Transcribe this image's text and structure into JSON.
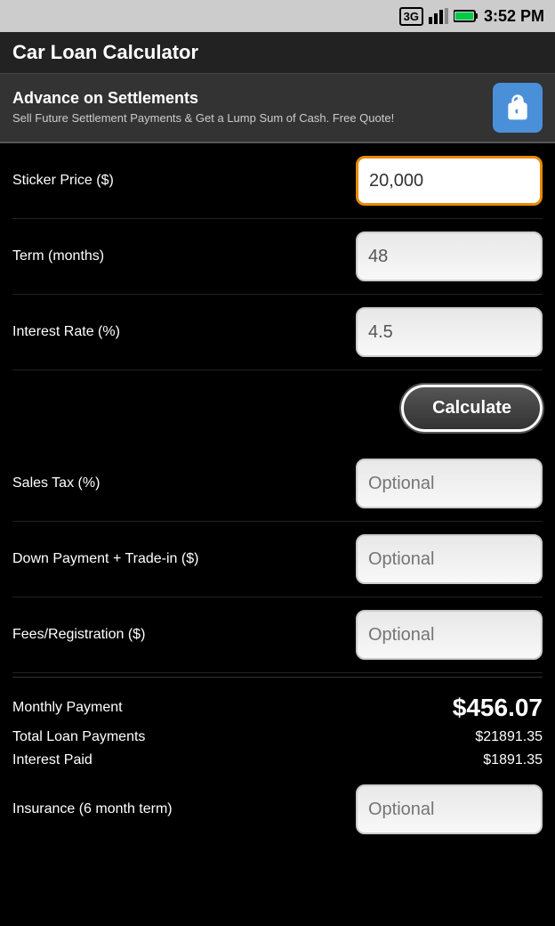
{
  "statusBar": {
    "time": "3:52 PM"
  },
  "titleBar": {
    "title": "Car Loan Calculator"
  },
  "adBanner": {
    "title": "Advance on Settlements",
    "subtitle": "Sell Future Settlement Payments & Get a Lump Sum of Cash. Free Quote!",
    "buttonIcon": "share"
  },
  "form": {
    "fields": [
      {
        "id": "sticker-price",
        "label": "Sticker Price ($)",
        "value": "20,000",
        "placeholder": "",
        "optional": false,
        "active": true
      },
      {
        "id": "term",
        "label": "Term (months)",
        "value": "48",
        "placeholder": "",
        "optional": false,
        "active": false
      },
      {
        "id": "interest-rate",
        "label": "Interest Rate (%)",
        "value": "4.5",
        "placeholder": "",
        "optional": false,
        "active": false
      }
    ],
    "optionalFields": [
      {
        "id": "sales-tax",
        "label": "Sales Tax (%)",
        "placeholder": "Optional"
      },
      {
        "id": "down-payment",
        "label": "Down Payment + Trade-in ($)",
        "placeholder": "Optional"
      },
      {
        "id": "fees-registration",
        "label": "Fees/Registration ($)",
        "placeholder": "Optional"
      }
    ],
    "calculateLabel": "Calculate"
  },
  "results": {
    "monthlyPaymentLabel": "Monthly Payment",
    "monthlyPaymentValue": "$456.07",
    "totalLoanLabel": "Total Loan Payments",
    "totalLoanValue": "$21891.35",
    "interestPaidLabel": "Interest Paid",
    "interestPaidValue": "$1891.35"
  },
  "insuranceField": {
    "label": "Insurance (6 month term)",
    "placeholder": "Optional"
  }
}
